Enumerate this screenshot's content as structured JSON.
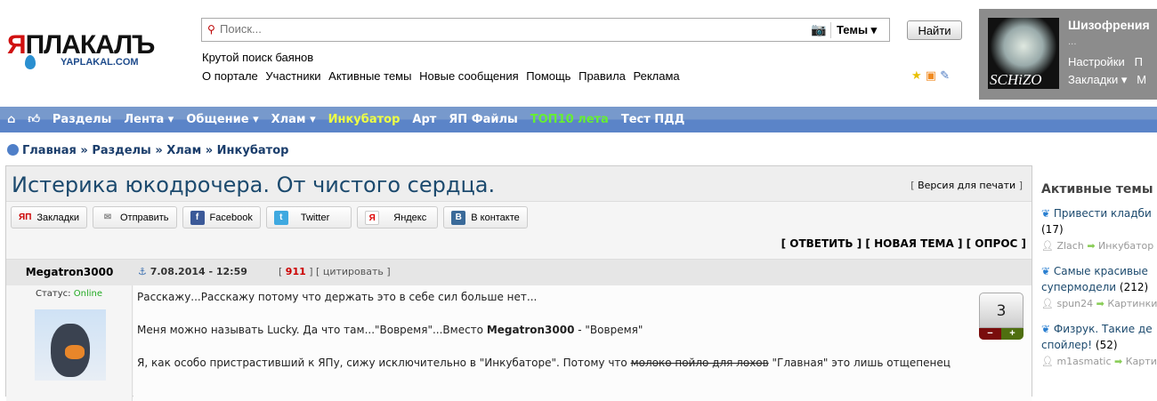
{
  "logo": {
    "text_red": "Я",
    "text": "ПЛАКАЛЪ",
    "domain": "YAPLAKAL.COM"
  },
  "search": {
    "placeholder": "Поиск...",
    "scope": "Темы ▾",
    "button": "Найти",
    "tagline": "Крутой поиск баянов"
  },
  "toplinks": [
    "О портале",
    "Участники",
    "Активные темы",
    "Новые сообщения",
    "Помощь",
    "Правила",
    "Реклама"
  ],
  "user": {
    "name": "Шизофрения",
    "dots": "...",
    "avatar_text": "SCHiZO",
    "links1": [
      "Настройки",
      "П"
    ],
    "links2": [
      "Закладки ▾",
      "М"
    ]
  },
  "nav": [
    "Разделы",
    "Лента ▾",
    "Общение ▾",
    "Хлам ▾",
    "Инкубатор",
    "Арт",
    "ЯП Файлы",
    "ТОП10 лета",
    "Тест ПДД"
  ],
  "breadcrumb": [
    "Главная",
    "Разделы",
    "Хлам",
    "Инкубатор"
  ],
  "topic": {
    "title": "Истерика юкодрочера. От чистого сердца.",
    "print": "Версия для печати"
  },
  "share": [
    "Закладки",
    "Отправить",
    "Facebook",
    "Twitter",
    "Яндекс",
    "В контакте"
  ],
  "actions": [
    "[ ОТВЕТИТЬ ]",
    "[ НОВАЯ ТЕМА ]",
    "[ ОПРОС ]"
  ],
  "post": {
    "author": "Megatron3000",
    "date": "7.08.2014 - 12:59",
    "num": "911",
    "quote": "цитировать",
    "status_label": "Статус:",
    "status": "Online",
    "p1": "Расскажу...Расскажу потому что держать это в себе сил больше нет...",
    "p2a": "Меня можно называть Lucky. Да что там...\"Вовремя\"...Вместо ",
    "p2b": "Megatron3000",
    "p2c": " - \"Вовремя\"",
    "p3a": "Я, как особо пристрастивший к ЯПу, сижу исключительно в \"Инкубаторе\". Потому что ",
    "p3s": "молоко пойло для лохов",
    "p3b": " \"Главная\" это лишь отщепенец",
    "rating": "3",
    "minus": "−",
    "plus": "+"
  },
  "sidebar": {
    "title": "Активные темы",
    "items": [
      {
        "title": "Привести кладби",
        "count": "(17)",
        "user": "Zlach",
        "section": "Инкубатор"
      },
      {
        "title": "Самые красивые",
        "title2": "супермодели",
        "count": "(212)",
        "user": "spun24",
        "section": "Картинки"
      },
      {
        "title": "Физрук. Такие де",
        "title2": "спойлер!",
        "count": "(52)",
        "user": "m1asmatic",
        "section": "Картинки"
      }
    ]
  }
}
